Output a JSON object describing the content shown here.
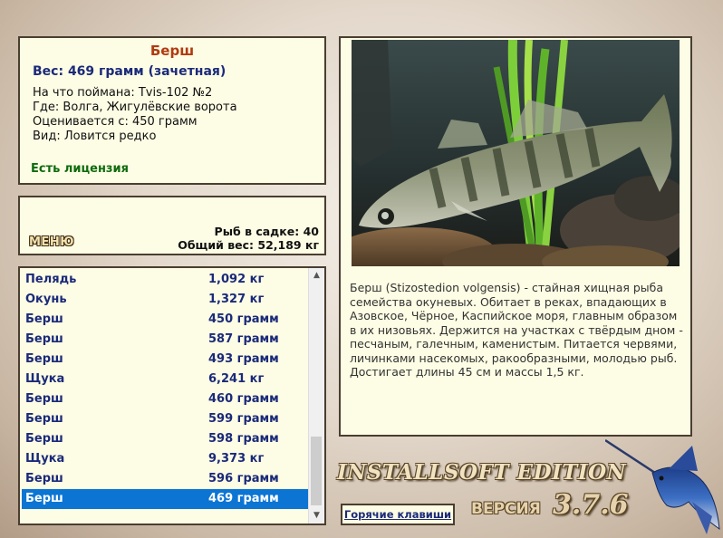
{
  "info": {
    "title": "Берш",
    "weight": "Вес: 469 грамм (зачетная)",
    "lines": [
      "На что поймана: Tvis-102 №2",
      "Где: Волга, Жигулёвские ворота",
      "Оценивается с: 450 грамм",
      "Вид: Ловится редко"
    ],
    "license": "Есть лицензия"
  },
  "cage": {
    "count": "Рыб в садке: 40",
    "total": "Общий вес: 52,189 кг",
    "menu_label": "МЕНЮ"
  },
  "catch_list": [
    {
      "name": "Пелядь",
      "weight": "1,092 кг"
    },
    {
      "name": "Окунь",
      "weight": "1,327 кг"
    },
    {
      "name": "Берш",
      "weight": "450 грамм"
    },
    {
      "name": "Берш",
      "weight": "587 грамм"
    },
    {
      "name": "Берш",
      "weight": "493 грамм"
    },
    {
      "name": "Щука",
      "weight": "6,241 кг"
    },
    {
      "name": "Берш",
      "weight": "460 грамм"
    },
    {
      "name": "Берш",
      "weight": "599 грамм"
    },
    {
      "name": "Берш",
      "weight": "598 грамм"
    },
    {
      "name": "Щука",
      "weight": "9,373 кг"
    },
    {
      "name": "Берш",
      "weight": "596 грамм"
    },
    {
      "name": "Берш",
      "weight": "469 грамм"
    }
  ],
  "selected_index": 11,
  "description": "Берш (Stizostedion volgensis) - стайная хищная рыба семейства окуневых. Обитает в реках, впадающих в Азовское, Чёрное, Каспийское моря, главным образом в их низовьях. Держится на участках с твёрдым дном - песчаным, галечным, каменистым. Питается червями, личинками насекомых, ракообразными, молодью рыб. Достигает длины 45 см и массы 1,5 кг.",
  "brand": "INSTALLSOFT EDITION",
  "version_label": "ВЕРСИЯ",
  "version": "3.7.6",
  "hotkeys_label": "Горячие клавиши",
  "colors": {
    "panel_bg": "#fdfce4",
    "panel_border": "#4a3e30",
    "title_red": "#b03a10",
    "list_blue": "#1a2a7a",
    "license_green": "#0e6b0e",
    "selection": "#0c75d4"
  }
}
